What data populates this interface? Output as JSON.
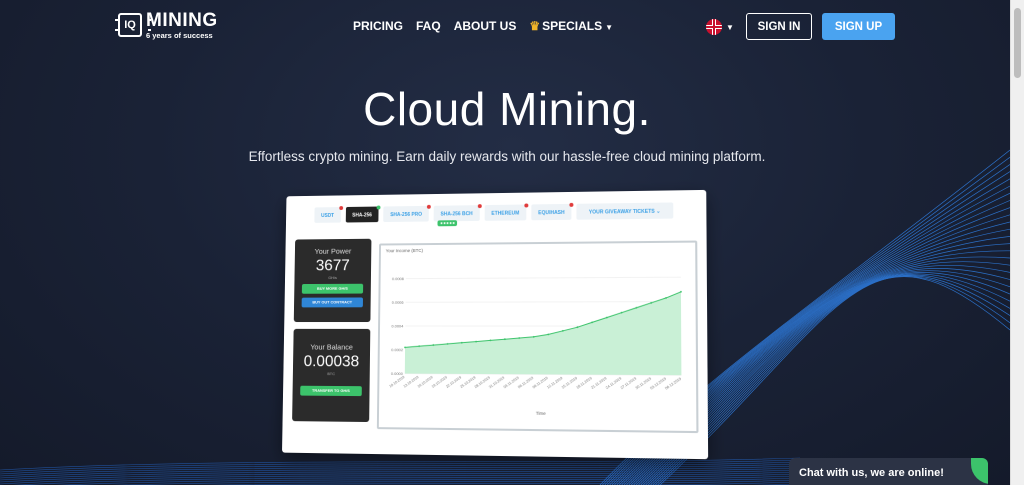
{
  "nav": {
    "logo": {
      "name": "MINING",
      "tagline": "6 years of success",
      "badge": "IQ"
    },
    "menu": [
      {
        "label": "PRICING"
      },
      {
        "label": "FAQ"
      },
      {
        "label": "ABOUT US"
      },
      {
        "label": "SPECIALS"
      }
    ],
    "signin_label": "SIGN IN",
    "signup_label": "SIGN UP"
  },
  "hero": {
    "title": "Cloud Mining.",
    "subtitle": "Effortless crypto mining. Earn daily rewards with our hassle-free cloud mining platform."
  },
  "mockup": {
    "tabs": [
      {
        "label": "USDT",
        "dot": "#e03b3b"
      },
      {
        "label": "SHA-256",
        "dot": "#3cc36b"
      },
      {
        "label": "SHA-256 PRO",
        "dot": "#e03b3b"
      },
      {
        "label": "SHA-256 BCH",
        "dot": "#e03b3b"
      },
      {
        "label": "ETHEREUM",
        "dot": "#e03b3b"
      },
      {
        "label": "EQUIHASH",
        "dot": "#e03b3b"
      },
      {
        "label": "YOUR GIVEAWAY TICKETS"
      }
    ],
    "power": {
      "label": "Your Power",
      "value": "3677",
      "unit": "GH/s",
      "btn1": "BUY MORE GH/S",
      "btn2": "BUY OUT CONTRACT"
    },
    "balance": {
      "label": "Your Balance",
      "value": "0.00038",
      "unit": "BTC",
      "btn": "TRANSFER TO GH/S"
    },
    "chart_title": "Your Income (BTC)"
  },
  "chart_data": {
    "type": "area",
    "title": "Your Income (BTC)",
    "xlabel": "Time",
    "ylabel": "",
    "ylim": [
      0,
      0.0009
    ],
    "y_ticks": [
      "0.0000",
      "0.0002",
      "0.0004",
      "0.0006",
      "0.0008"
    ],
    "x": [
      "10.10.2019",
      "13.10.2019",
      "16.10.2019",
      "19.10.2019",
      "22.10.2019",
      "25.10.2019",
      "28.10.2019",
      "31.10.2019",
      "03.11.2019",
      "06.11.2019",
      "09.11.2019",
      "12.11.2019",
      "15.11.2019",
      "18.11.2019",
      "21.11.2019",
      "24.11.2019",
      "27.11.2019",
      "30.11.2019",
      "03.12.2019",
      "06.12.2019"
    ],
    "values": [
      0.00022,
      0.00023,
      0.00024,
      0.00025,
      0.00026,
      0.00027,
      0.00028,
      0.00029,
      0.0003,
      0.00031,
      0.00033,
      0.00036,
      0.00039,
      0.00043,
      0.00047,
      0.00051,
      0.00055,
      0.00059,
      0.00063,
      0.00068
    ],
    "color": "#3cc36b",
    "fill": "#c9f0d6"
  },
  "chat": {
    "label": "Chat with us, we are online!"
  },
  "colors": {
    "accent": "#4aa3f0",
    "background": "#1a2236",
    "success": "#3cc36b"
  }
}
